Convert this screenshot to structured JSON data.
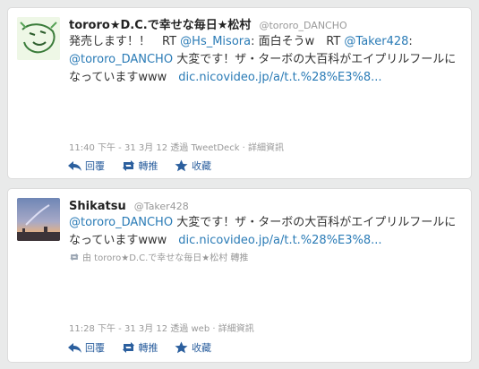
{
  "tweets": [
    {
      "name": "tororo★D.C.で幸せな毎日★松村",
      "handle": "@tororo_DANCHO",
      "lines": [
        [
          {
            "t": "発売します！！　RT "
          },
          {
            "t": "@Hs_Misora",
            "link": true
          },
          {
            "t": ": 面白そうw　RT "
          },
          {
            "t": "@Taker428",
            "link": true
          },
          {
            "t": ":"
          }
        ],
        [
          {
            "t": "@tororo_DANCHO",
            "link": true
          },
          {
            "t": " 大変です！ザ・ターボの大百科がエイプリルフールに"
          }
        ],
        [
          {
            "t": "なっていますwww　"
          },
          {
            "t": "dic.nicovideo.jp/a/t.t.%28%E3%8...",
            "link": true
          }
        ]
      ],
      "meta": "11:40 下午 - 31 3月 12 透過 TweetDeck · 詳細資訊"
    },
    {
      "name": "Shikatsu",
      "handle": "@Taker428",
      "lines": [
        [
          {
            "t": "@tororo_DANCHO",
            "link": true
          },
          {
            "t": " 大変です！ザ・ターボの大百科がエイプリルフールに"
          }
        ],
        [
          {
            "t": "なっていますwww　"
          },
          {
            "t": "dic.nicovideo.jp/a/t.t.%28%E3%8...",
            "link": true
          }
        ]
      ],
      "retweet_note": "由 tororo★D.C.で幸せな毎日★松村 轉推",
      "meta": "11:28 下午 - 31 3月 12 透過 web · 詳細資訊"
    }
  ],
  "actions": {
    "reply": "回覆",
    "retweet": "轉推",
    "favorite": "收藏"
  },
  "colors": {
    "link": "#2a7bb6",
    "action": "#2b5f9e",
    "meta": "#999999"
  }
}
